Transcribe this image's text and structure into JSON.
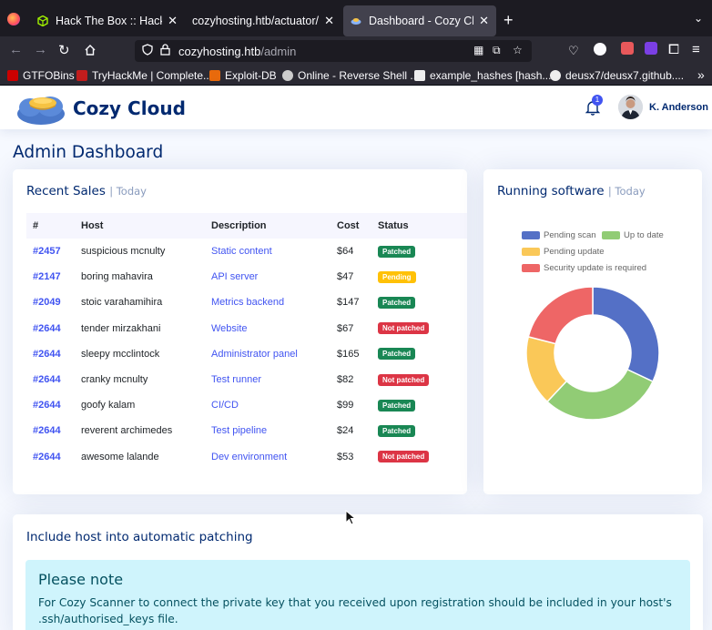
{
  "browser": {
    "tabs": [
      {
        "title": "Hack The Box :: Hack The",
        "favicon": "hackthebox-cube-icon",
        "active": false
      },
      {
        "title": "cozyhosting.htb/actuator/ses",
        "favicon": "",
        "active": false
      },
      {
        "title": "Dashboard - Cozy Cloud",
        "favicon": "cozy-cloud-favicon",
        "active": true
      }
    ],
    "url_host": "cozyhosting.htb",
    "url_path": "/admin",
    "bookmarks": [
      {
        "label": "GTFOBins",
        "icon": "gtfobins-icon",
        "color": "#c00"
      },
      {
        "label": "TryHackMe | Complete...",
        "icon": "tryhackme-icon",
        "color": "#c11d1d"
      },
      {
        "label": "Exploit-DB",
        "icon": "exploitdb-icon",
        "color": "#e86a0c"
      },
      {
        "label": "Online - Reverse Shell ...",
        "icon": "skull-icon",
        "color": "#ccc"
      },
      {
        "label": "example_hashes [hash...",
        "icon": "hashcat-icon",
        "color": "#eee"
      },
      {
        "label": "deusx7/deusx7.github....",
        "icon": "github-icon",
        "color": "#eee"
      }
    ]
  },
  "header": {
    "brand": "Cozy Cloud",
    "notification_count": "1",
    "user_name": "K. Anderson"
  },
  "page_title": "Admin Dashboard",
  "sales": {
    "title": "Recent Sales",
    "subtitle": "| Today",
    "columns": [
      "#",
      "Host",
      "Description",
      "Cost",
      "Status"
    ],
    "rows": [
      {
        "id": "#2457",
        "host": "suspicious mcnulty",
        "description": "Static content",
        "cost": "$64",
        "status": "Patched"
      },
      {
        "id": "#2147",
        "host": "boring mahavira",
        "description": "API server",
        "cost": "$47",
        "status": "Pending"
      },
      {
        "id": "#2049",
        "host": "stoic varahamihira",
        "description": "Metrics backend",
        "cost": "$147",
        "status": "Patched"
      },
      {
        "id": "#2644",
        "host": "tender mirzakhani",
        "description": "Website",
        "cost": "$67",
        "status": "Not patched"
      },
      {
        "id": "#2644",
        "host": "sleepy mcclintock",
        "description": "Administrator panel",
        "cost": "$165",
        "status": "Patched"
      },
      {
        "id": "#2644",
        "host": "cranky mcnulty",
        "description": "Test runner",
        "cost": "$82",
        "status": "Not patched"
      },
      {
        "id": "#2644",
        "host": "goofy kalam",
        "description": "CI/CD",
        "cost": "$99",
        "status": "Patched"
      },
      {
        "id": "#2644",
        "host": "reverent archimedes",
        "description": "Test pipeline",
        "cost": "$24",
        "status": "Patched"
      },
      {
        "id": "#2644",
        "host": "awesome lalande",
        "description": "Dev environment",
        "cost": "$53",
        "status": "Not patched"
      }
    ],
    "status_colors": {
      "Patched": "#198754",
      "Pending": "#ffc107",
      "Not patched": "#dc3545"
    }
  },
  "software": {
    "title": "Running software",
    "subtitle": "| Today"
  },
  "chart_data": {
    "type": "pie",
    "categories": [
      "Pending scan",
      "Up to date",
      "Pending update",
      "Security update is required"
    ],
    "values": [
      32,
      30,
      17,
      21
    ],
    "colors": [
      "#5470c6",
      "#91cc75",
      "#fac858",
      "#ee6666"
    ],
    "legend_position": "top"
  },
  "patching": {
    "title": "Include host into automatic patching",
    "note_heading": "Please note",
    "note_text": "For Cozy Scanner to connect the private key that you received upon registration should be included in your host's .ssh/authorised_keys file."
  }
}
